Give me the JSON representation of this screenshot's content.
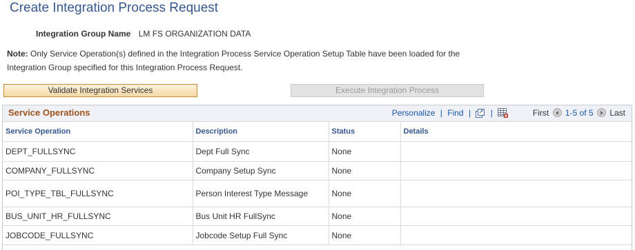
{
  "page": {
    "title": "Create Integration Process Request"
  },
  "integration_group": {
    "label": "Integration Group Name",
    "value": "LM FS ORGANIZATION DATA"
  },
  "note": {
    "label": "Note:",
    "text": "Only Service Operation(s) defined in the Integration Process Service Operation Setup Table have been loaded for the Integration Group specified for this Integration Process Request."
  },
  "buttons": {
    "validate": "Validate Integration Services",
    "execute": "Execute Integration Process"
  },
  "grid": {
    "title": "Service Operations",
    "toolbar": {
      "personalize": "Personalize",
      "separator": "|",
      "find": "Find",
      "first": "First",
      "range": "1-5 of 5",
      "last": "Last",
      "view_all_icon": "view-all-icon",
      "download_icon": "download-excel-icon"
    },
    "columns": [
      "Service Operation",
      "Description",
      "Status",
      "Details"
    ],
    "rows": [
      {
        "operation": "DEPT_FULLSYNC",
        "description": "Dept Full Sync",
        "status": "None",
        "details": ""
      },
      {
        "operation": "COMPANY_FULLSYNC",
        "description": "Company Setup Sync",
        "status": "None",
        "details": ""
      },
      {
        "operation": "POI_TYPE_TBL_FULLSYNC",
        "description": "Person Interest Type Message",
        "status": "None",
        "details": ""
      },
      {
        "operation": "BUS_UNIT_HR_FULLSYNC",
        "description": "Bus Unit HR FullSync",
        "status": "None",
        "details": ""
      },
      {
        "operation": "JOBCODE_FULLSYNC",
        "description": "Jobcode Setup Full Sync",
        "status": "None",
        "details": ""
      }
    ]
  },
  "colors": {
    "title": "#36578f",
    "grid_title": "#a0521c",
    "link": "#1a57a8",
    "validate_border": "#c98a2f"
  }
}
